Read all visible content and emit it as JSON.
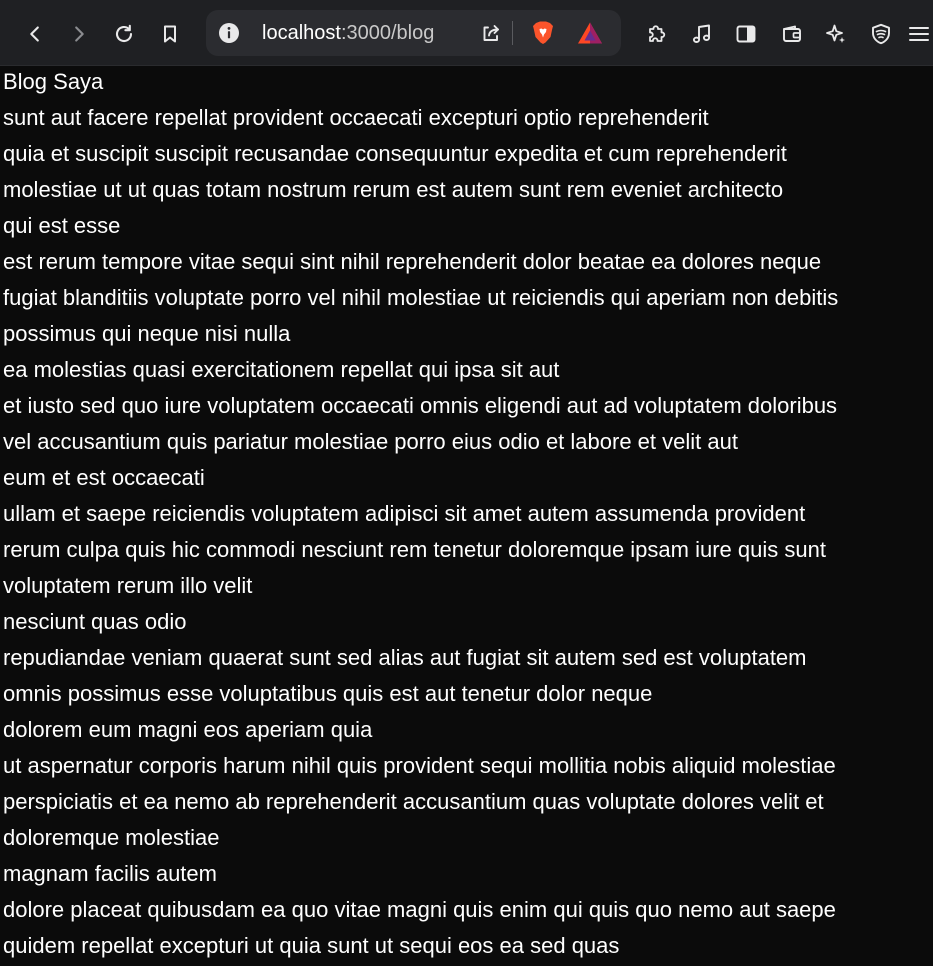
{
  "browser": {
    "url_host": "localhost",
    "url_rest": ":3000/blog",
    "icons": {
      "back": "back-arrow-icon",
      "forward": "forward-arrow-icon",
      "reload": "reload-icon",
      "bookmark": "bookmark-icon",
      "info": "info-icon",
      "share": "share-icon",
      "brave": "brave-lion-icon",
      "bat": "bat-triangle-icon",
      "extensions": "puzzle-icon",
      "music": "music-note-icon",
      "sidebar": "sidebar-icon",
      "wallet": "wallet-icon",
      "leo": "sparkle-icon",
      "vpn": "shield-icon",
      "menu": "hamburger-menu-icon"
    },
    "colors": {
      "toolbar_bg": "#1f2023",
      "urlbar_bg": "#2b2c30",
      "brave_orange": "#fb542b",
      "bat_purple": "#662d91",
      "bat_red": "#ff4724"
    }
  },
  "page": {
    "title": "Blog Saya",
    "lines": [
      "sunt aut facere repellat provident occaecati excepturi optio reprehenderit",
      "quia et suscipit suscipit recusandae consequuntur expedita et cum reprehenderit",
      "molestiae ut ut quas totam nostrum rerum est autem sunt rem eveniet architecto",
      "qui est esse",
      "est rerum tempore vitae sequi sint nihil reprehenderit dolor beatae ea dolores neque",
      "fugiat blanditiis voluptate porro vel nihil molestiae ut reiciendis qui aperiam non debitis",
      "possimus qui neque nisi nulla",
      "ea molestias quasi exercitationem repellat qui ipsa sit aut",
      "et iusto sed quo iure voluptatem occaecati omnis eligendi aut ad voluptatem doloribus",
      "vel accusantium quis pariatur molestiae porro eius odio et labore et velit aut",
      "eum et est occaecati",
      "ullam et saepe reiciendis voluptatem adipisci sit amet autem assumenda provident",
      "rerum culpa quis hic commodi nesciunt rem tenetur doloremque ipsam iure quis sunt",
      "voluptatem rerum illo velit",
      "nesciunt quas odio",
      "repudiandae veniam quaerat sunt sed alias aut fugiat sit autem sed est voluptatem",
      "omnis possimus esse voluptatibus quis est aut tenetur dolor neque",
      "dolorem eum magni eos aperiam quia",
      "ut aspernatur corporis harum nihil quis provident sequi mollitia nobis aliquid molestiae",
      "perspiciatis et ea nemo ab reprehenderit accusantium quas voluptate dolores velit et",
      "doloremque molestiae",
      "magnam facilis autem",
      "dolore placeat quibusdam ea quo vitae magni quis enim qui quis quo nemo aut saepe",
      "quidem repellat excepturi ut quia sunt ut sequi eos ea sed quas"
    ]
  }
}
